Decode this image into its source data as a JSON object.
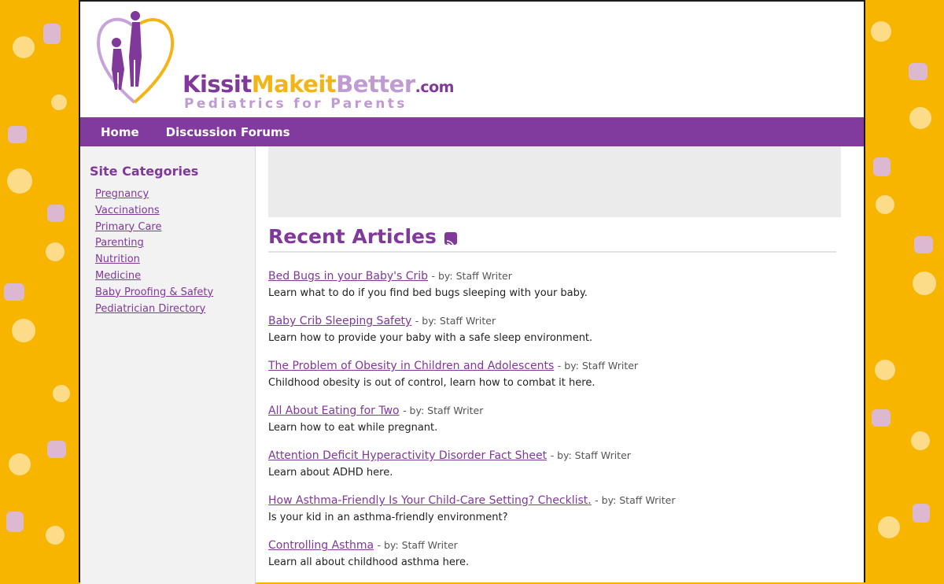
{
  "brand": {
    "name_part1": "Kissit",
    "name_part2": "Makeit",
    "name_part3": "Better",
    "name_tld": ".com",
    "tagline": "Pediatrics for Parents"
  },
  "nav": [
    {
      "label": "Home"
    },
    {
      "label": "Discussion Forums"
    }
  ],
  "sidebar": {
    "title": "Site Categories",
    "items": [
      {
        "label": "Pregnancy"
      },
      {
        "label": "Vaccinations"
      },
      {
        "label": "Primary Care"
      },
      {
        "label": "Parenting"
      },
      {
        "label": "Nutrition"
      },
      {
        "label": "Medicine"
      },
      {
        "label": "Baby Proofing & Safety"
      },
      {
        "label": "Pediatrician Directory"
      }
    ]
  },
  "main": {
    "section_title": "Recent Articles",
    "articles": [
      {
        "title": "Bed Bugs in your Baby's Crib",
        "byline": "- by: Staff Writer",
        "desc": "Learn what to do if you find bed bugs sleeping with your baby."
      },
      {
        "title": "Baby Crib Sleeping Safety",
        "byline": "- by: Staff Writer",
        "desc": "Learn how to provide your baby with a safe sleep environment."
      },
      {
        "title": "The Problem of Obesity in Children and Adolescents",
        "byline": "- by: Staff Writer",
        "desc": "Childhood obesity is out of control, learn how to combat it here."
      },
      {
        "title": "All About Eating for Two",
        "byline": "- by: Staff Writer",
        "desc": "Learn how to eat while pregnant."
      },
      {
        "title": "Attention Deficit Hyperactivity Disorder Fact Sheet",
        "byline": "- by: Staff Writer",
        "desc": "Learn about ADHD here."
      },
      {
        "title": "How Asthma-Friendly Is Your Child-Care Setting? Checklist.",
        "byline": "- by: Staff Writer",
        "desc": "Is your kid in an asthma-friendly environment?"
      },
      {
        "title": "Controlling Asthma",
        "byline": "- by: Staff Writer",
        "desc": "Learn all about childhood asthma here."
      }
    ]
  },
  "colors": {
    "brand_purple": "#813b9e",
    "brand_yellow": "#f7b500",
    "brand_lilac": "#c09ad2"
  }
}
